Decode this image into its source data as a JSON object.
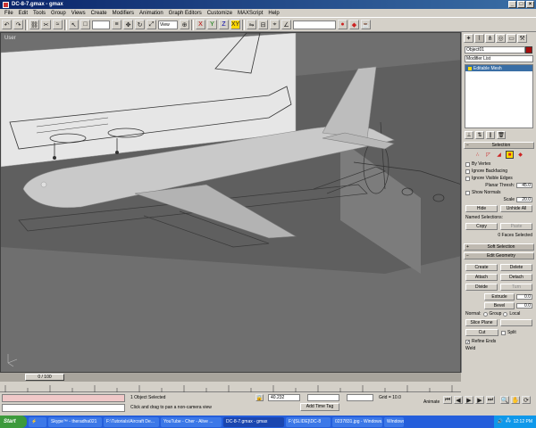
{
  "window": {
    "title": "DC-8-7.gmax - gmax"
  },
  "menu": [
    "File",
    "Edit",
    "Tools",
    "Group",
    "Views",
    "Create",
    "Modifiers",
    "Animation",
    "Graph Editors",
    "Customize",
    "MAXScript",
    "Help"
  ],
  "toolbar": {
    "view_dropdown": "View"
  },
  "viewport": {
    "label": "User"
  },
  "command_panel": {
    "object_name": "Object01",
    "modifier_list": "Modifier List",
    "stack_item": "Editable Mesh",
    "selection": {
      "title": "Selection",
      "by_vertex": "By Vertex",
      "ignore_backfacing": "Ignore Backfacing",
      "ignore_visible_edges": "Ignore Visible Edges",
      "planar_thresh_label": "Planar Thresh:",
      "planar_thresh_value": "45.0",
      "show_normals": "Show Normals",
      "scale_label": "Scale",
      "scale_value": "20.0",
      "hide": "Hide",
      "unhide_all": "Unhide All",
      "named_selections": "Named Selections:",
      "copy": "Copy",
      "paste": "Paste",
      "faces_selected": "0 Faces Selected"
    },
    "soft_selection": {
      "title": "Soft Selection"
    },
    "edit_geometry": {
      "title": "Edit Geometry",
      "create": "Create",
      "delete": "Delete",
      "attach": "Attach",
      "detach": "Detach",
      "divide": "Divide",
      "turn": "Turn",
      "extrude": "Extrude",
      "extrude_value": "0.0",
      "bevel": "Bevel",
      "bevel_value": "0.0",
      "normal": "Normal:",
      "group": "Group",
      "local": "Local",
      "slice_plane": "Slice Plane",
      "cut": "Cut",
      "split": "Split",
      "refine_ends": "Refine Ends",
      "weld": "Weld"
    }
  },
  "timeline": {
    "slider_label": "0 / 100"
  },
  "status": {
    "objects_selected": "1 Object Selected",
    "prompt": "Click and drag to pan a non-camera view",
    "add_time_tag": "Add Time Tag",
    "x_value": "40.232",
    "grid": "Grid = 10.0",
    "animate": "Animate"
  },
  "taskbar": {
    "start": "Start",
    "tasks": [
      "Skype™ - theradha021",
      "F:\\Tutorials\\Aircraft De...",
      "YouTube - Cher - Alive ...",
      "DC-8-7.gmax - gmax",
      "F:\\[SLIDE]\\DC-8",
      "0237831.jpg - Windows...",
      "Windows..."
    ],
    "active_task_index": 3,
    "clock": "12:12 PM"
  },
  "colors": {
    "viewport_bg": "#6f6f6f",
    "selection_highlight": "#3a6ea5",
    "object_color": "#a60d0d",
    "active_tool": "#ffd800"
  }
}
